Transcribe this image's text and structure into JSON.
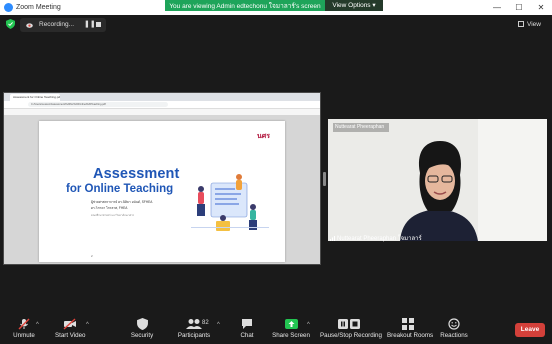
{
  "window": {
    "title": "Zoom Meeting",
    "controls": {
      "minimize": "—",
      "maximize": "☐",
      "close": "✕"
    }
  },
  "share_banner": {
    "text": "You are viewing Admin edtechonu ใจมาลาร์'s screen",
    "view_options_label": "View Options ▾"
  },
  "meeting_bar": {
    "recording_label": "Recording...",
    "pause_symbol": "❚❚",
    "view_label": "View"
  },
  "shared_screen": {
    "browser_tab_title": "Assessment for Online Teaching.pdf",
    "url": "C:/Users/Lesson/Assessment%20for%20Online%20Teaching.pdf",
    "slide": {
      "logo": "นศร",
      "title_line1": "Assessment",
      "title_line2": "for Online Teaching",
      "credit_line1": "ผู้ช่วยศาสตราจารย์ ดร.นิติยา อนันต์, SFHEA",
      "credit_line2": "ดร.วิภาดา ไกรลาศ, FHEA",
      "credit_line3": "คณะศึกษาศาสตร์ มหาวิทยาลัยนเรศวร",
      "page_number": "2"
    }
  },
  "participant": {
    "tile_label": "Nuttearat Pheeraphan",
    "name": "Nuttearat Pheeraphan ใจมาลาร์"
  },
  "toolbar": {
    "unmute": "Unmute",
    "start_video": "Start Video",
    "security": "Security",
    "participants": "Participants",
    "participants_count": "82",
    "chat": "Chat",
    "share_screen": "Share Screen",
    "pause_stop_recording": "Pause/Stop Recording",
    "breakout_rooms": "Breakout Rooms",
    "reactions": "Reactions",
    "leave": "Leave",
    "caret": "^"
  },
  "colors": {
    "banner_green": "#1ea45a",
    "leave_red": "#d3403a",
    "slide_title_blue": "#1f56b6",
    "share_screen_green": "#23c552"
  }
}
